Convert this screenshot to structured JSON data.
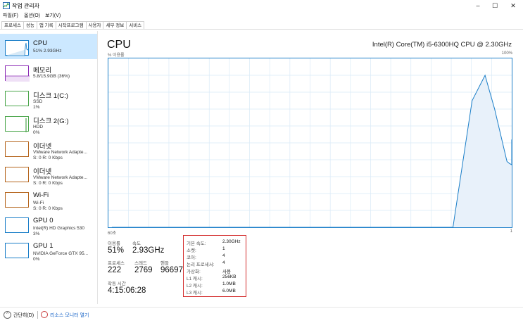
{
  "window": {
    "title": "작업 관리자",
    "minimize": "–",
    "maximize": "☐",
    "close": "✕"
  },
  "menu": [
    "파일(F)",
    "옵션(O)",
    "보기(V)"
  ],
  "tabs": [
    "프로세스",
    "성능",
    "앱 기록",
    "시작프로그램",
    "사용자",
    "세부 정보",
    "서비스"
  ],
  "active_tab": "성능",
  "sidebar": {
    "items": [
      {
        "title": "CPU",
        "sub1": "51% 2.93GHz",
        "sub2": "",
        "color": "#1a7ec8"
      },
      {
        "title": "메모리",
        "sub1": "5.8/15.9GB (36%)",
        "sub2": "",
        "color": "#8b2bb5"
      },
      {
        "title": "디스크 1(C:)",
        "sub1": "SSD",
        "sub2": "1%",
        "color": "#4ca64c"
      },
      {
        "title": "디스크 2(G:)",
        "sub1": "HDD",
        "sub2": "0%",
        "color": "#4ca64c"
      },
      {
        "title": "이더넷",
        "sub1": "VMware Network Adapte...",
        "sub2": "S: 0 R: 0 Kbps",
        "color": "#b5651d"
      },
      {
        "title": "이더넷",
        "sub1": "VMware Network Adapte...",
        "sub2": "S: 0 R: 0 Kbps",
        "color": "#b5651d"
      },
      {
        "title": "Wi-Fi",
        "sub1": "Wi-Fi",
        "sub2": "S: 0 R: 0 Kbps",
        "color": "#b5651d"
      },
      {
        "title": "GPU 0",
        "sub1": "Intel(R) HD Graphics 530",
        "sub2": "3%",
        "color": "#1a7ec8"
      },
      {
        "title": "GPU 1",
        "sub1": "NVIDIA GeForce GTX 95...",
        "sub2": "0%",
        "color": "#1a7ec8"
      }
    ]
  },
  "main": {
    "title": "CPU",
    "model": "Intel(R) Core(TM) i5-6300HQ CPU @ 2.30GHz",
    "y_label": "% 이용률",
    "y_max": "100%",
    "x_left": "60초",
    "x_right": "1"
  },
  "cpu_usage_history": [
    0,
    0,
    0,
    0,
    0,
    0,
    0,
    0,
    0,
    0,
    0,
    0,
    0,
    0,
    0,
    0,
    0,
    0,
    0,
    0,
    0,
    0,
    0,
    0,
    0,
    0,
    0,
    0,
    0,
    0,
    0,
    0,
    0,
    0,
    0,
    0,
    0,
    0,
    0,
    0,
    0,
    0,
    0,
    0,
    0,
    0,
    0,
    0,
    0,
    0,
    0,
    0,
    0,
    0,
    0,
    0,
    0,
    0,
    0,
    0,
    0,
    0,
    0,
    0,
    0,
    0,
    0,
    0,
    0,
    0,
    0,
    0,
    0,
    0,
    0,
    0,
    0,
    0,
    0,
    0,
    0,
    0,
    0,
    0,
    0,
    0,
    0,
    0,
    0,
    0,
    0,
    0,
    0,
    0,
    0,
    0,
    0,
    0,
    0,
    0,
    0,
    0,
    0,
    0,
    0,
    0,
    0,
    0,
    0,
    0,
    0,
    0,
    0,
    0,
    0,
    0,
    0,
    0,
    0,
    0,
    0,
    0,
    0,
    0,
    0,
    0,
    0,
    0,
    0,
    0,
    0,
    0,
    0,
    0,
    0,
    0,
    0,
    0,
    0,
    0,
    0,
    0,
    0,
    0,
    0,
    0,
    0,
    0,
    0,
    0,
    0,
    0,
    0,
    0,
    0,
    0,
    0,
    0,
    0,
    0,
    0,
    0,
    0,
    0,
    0,
    0,
    0,
    0,
    0,
    0,
    0,
    0,
    0,
    0,
    0,
    0,
    0,
    0,
    0,
    0,
    0,
    0,
    0,
    0,
    0,
    0,
    0,
    0,
    0,
    0,
    0,
    0,
    0,
    0,
    0,
    0,
    0,
    0,
    0,
    0,
    0,
    0,
    0,
    0,
    0,
    0,
    0,
    0,
    0,
    0,
    0,
    0,
    0,
    0,
    0,
    0,
    0,
    0,
    0,
    0,
    0,
    0,
    0,
    0,
    0,
    0,
    0,
    0,
    0,
    0,
    0,
    0,
    0,
    0,
    0,
    0,
    0,
    0,
    0,
    0,
    0,
    0,
    0,
    0,
    0,
    0,
    0,
    0,
    0,
    0,
    0,
    0,
    0,
    0,
    0,
    0,
    0,
    0,
    0,
    0,
    0,
    0,
    0,
    0,
    0,
    0,
    0,
    0,
    0,
    0,
    0,
    0,
    0,
    0,
    0,
    0,
    0,
    0,
    0,
    0,
    0,
    0,
    0,
    0,
    0,
    0,
    0,
    0,
    0,
    0,
    0,
    0,
    0,
    0,
    0,
    0,
    0,
    0,
    0,
    0,
    0,
    0,
    0,
    0,
    0,
    0,
    0,
    0,
    0,
    0,
    0,
    0,
    0,
    0,
    0,
    0,
    0,
    0,
    0,
    0,
    0,
    0,
    0,
    0,
    0,
    0,
    0,
    0,
    0,
    0,
    0,
    0,
    0,
    0,
    0,
    0,
    0,
    0,
    0,
    0,
    0,
    0,
    0,
    0,
    0,
    0,
    0,
    0,
    0,
    0,
    0,
    0,
    0,
    0,
    0,
    0,
    0,
    0,
    0,
    0,
    0,
    0,
    0,
    0,
    0,
    0,
    0,
    0,
    0,
    0,
    0,
    0,
    0,
    0,
    0,
    0,
    0,
    0,
    0,
    0,
    0,
    0,
    0,
    0,
    0,
    0,
    0,
    0,
    0,
    0,
    0,
    0,
    0,
    0,
    0,
    0,
    0,
    0,
    0,
    0,
    0,
    0,
    0,
    0,
    0,
    0,
    0,
    0,
    0,
    0,
    0,
    0,
    0,
    0,
    0,
    0,
    0,
    0,
    0,
    0,
    0,
    0,
    0,
    0,
    0,
    0,
    0,
    0,
    0,
    0,
    0,
    0,
    0,
    0,
    0,
    0,
    0,
    0,
    0,
    0,
    0,
    0,
    0,
    0,
    0,
    0,
    0,
    0,
    0,
    0,
    0,
    0,
    0,
    0,
    0,
    0,
    0,
    0,
    0,
    0,
    0,
    0,
    0,
    0,
    0,
    0,
    0,
    0,
    0,
    0,
    0,
    0,
    0,
    0,
    0,
    0,
    0,
    0,
    0,
    0,
    0,
    0,
    0,
    0,
    0,
    0,
    0,
    0,
    0,
    0,
    0,
    0,
    0,
    0,
    0,
    0,
    0,
    0,
    0,
    0,
    0,
    0,
    0,
    0,
    0,
    0,
    0,
    0,
    0,
    0,
    0,
    0,
    0,
    0,
    0,
    0,
    0,
    0,
    0,
    0,
    0,
    0,
    0,
    0,
    0,
    0,
    0,
    0,
    0,
    0,
    0,
    0,
    0,
    0,
    0,
    0,
    0,
    0,
    0,
    0,
    0,
    0,
    0,
    0,
    0,
    0,
    0,
    0,
    0,
    0,
    0,
    0,
    0,
    0,
    0,
    0,
    0,
    0,
    0,
    0
  ],
  "cpu_trend": [
    {
      "t": 59.5,
      "v": 0
    },
    {
      "t": 59,
      "v": 0
    },
    {
      "t": 9.6,
      "v": 0
    },
    {
      "t": 6.8,
      "v": 75
    },
    {
      "t": 4.9,
      "v": 90
    },
    {
      "t": 3.5,
      "v": 70
    },
    {
      "t": 1.7,
      "v": 39
    },
    {
      "t": 1.4,
      "v": 38
    },
    {
      "t": 0.9,
      "v": 37
    },
    {
      "t": 0.4,
      "v": 38
    },
    {
      "t": -0.3,
      "v": 52
    },
    {
      "t": -0.9,
      "v": 46
    },
    {
      "t": -1.5,
      "v": 50
    }
  ],
  "stats": {
    "util_label": "이용률",
    "util_value": "51%",
    "speed_label": "속도",
    "speed_value": "2.93GHz",
    "proc_label": "프로세스",
    "proc_value": "222",
    "thread_label": "스레드",
    "thread_value": "2769",
    "handle_label": "핸들",
    "handle_value": "96697",
    "uptime_label": "작동 시간",
    "uptime_value": "4:15:06:28"
  },
  "info": [
    {
      "k": "기본 속도:",
      "v": "2.30GHz"
    },
    {
      "k": "소켓:",
      "v": "1"
    },
    {
      "k": "코어:",
      "v": "4"
    },
    {
      "k": "논리 프로세서:",
      "v": "4"
    },
    {
      "k": "가상화:",
      "v": "사용"
    },
    {
      "k": "L1 캐시:",
      "v": "256KB"
    },
    {
      "k": "L2 캐시:",
      "v": "1.0MB"
    },
    {
      "k": "L3 캐시:",
      "v": "6.0MB"
    }
  ],
  "footer": {
    "less_details": "간단히(D)",
    "resmon": "리소스 모니터 열기"
  }
}
